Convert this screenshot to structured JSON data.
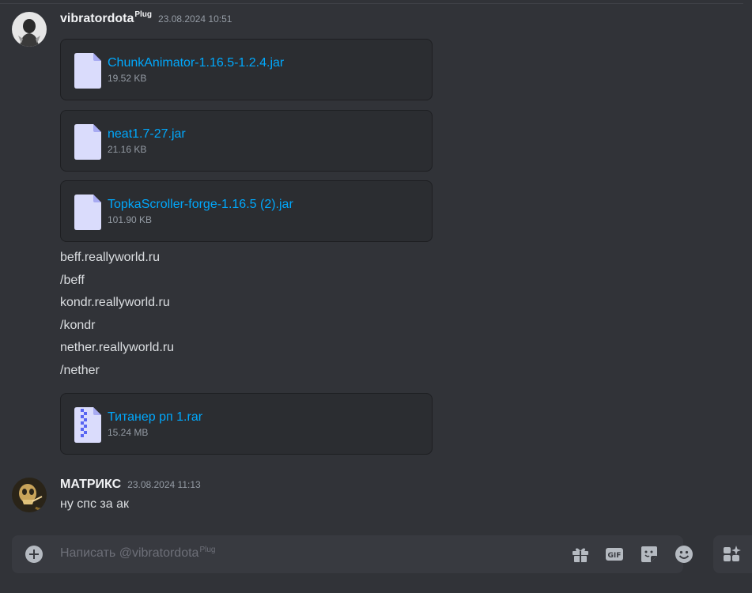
{
  "messages": [
    {
      "author": "vibratordota",
      "author_tag": "Plug",
      "timestamp": "23.08.2024 10:51",
      "attachments_top": [
        {
          "name": "ChunkAnimator-1.16.5-1.2.4.jar",
          "size": "19.52 KB",
          "icon": "file-icon"
        },
        {
          "name": "neat1.7-27.jar",
          "size": "21.16 KB",
          "icon": "file-icon"
        },
        {
          "name": "TopkaScroller-forge-1.16.5 (2).jar",
          "size": "101.90 KB",
          "icon": "file-icon"
        }
      ],
      "lines": [
        "beff.reallyworld.ru",
        "/beff",
        "kondr.reallyworld.ru",
        "/kondr",
        "nether.reallyworld.ru",
        "/nether"
      ],
      "attachments_bottom": [
        {
          "name": "Титанер рп 1.rar",
          "size": "15.24 MB",
          "icon": "archive-icon"
        }
      ]
    },
    {
      "author": "МАТРИКС",
      "timestamp": "23.08.2024 11:13",
      "text": "ну спс за ак"
    }
  ],
  "composer": {
    "placeholder": "Написать @vibratordota",
    "placeholder_tag": "Plug",
    "buttons": [
      "plus-icon",
      "gift-icon",
      "gif-icon",
      "sticker-icon",
      "emoji-icon",
      "apps-icon"
    ]
  },
  "colors": {
    "background": "#313338",
    "attachment_bg": "#2b2d31",
    "link": "#00a8fc",
    "muted": "#949ba4",
    "icon": "#b5bac1",
    "composer_bg": "#383a40"
  }
}
